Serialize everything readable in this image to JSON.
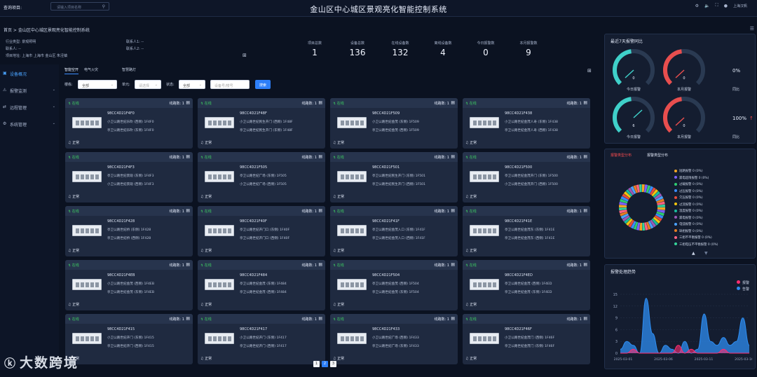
{
  "topbar": {
    "query_label": "查询项目:",
    "query_placeholder": "请输入项目名称",
    "title": "金山区中心城区景观亮化智能控制系统",
    "user": "上海汉帆"
  },
  "breadcrumb": "首页 > 金山区中心城区景观亮化智能控制系统",
  "info": {
    "l1": "行业类型: 景观照明",
    "l2": "联系人: --",
    "l3": "项目地址: 上海市 上海市 金山区 朱泾镇",
    "r1": "联系人1: --",
    "r2": "联系人2: --"
  },
  "stats": [
    {
      "label": "项目总数",
      "value": "1"
    },
    {
      "label": "设备总数",
      "value": "136"
    },
    {
      "label": "在线设备数",
      "value": "132"
    },
    {
      "label": "离线设备数",
      "value": "4"
    },
    {
      "label": "今日报警数",
      "value": "0"
    },
    {
      "label": "本月报警数",
      "value": "9"
    }
  ],
  "sidebar": [
    {
      "label": "设备概况",
      "icon": "monitor-icon"
    },
    {
      "label": "报警监测",
      "icon": "alarm-icon"
    },
    {
      "label": "远程管理",
      "icon": "remote-icon"
    },
    {
      "label": "系统管理",
      "icon": "settings-icon"
    }
  ],
  "tabs": [
    "智能空开",
    "电气火灾",
    "智慧路灯"
  ],
  "filters": {
    "building_label": "楼栋:",
    "building_value": "全部",
    "unit_label": "单元:",
    "unit_placeholder": "请选择",
    "status_label": "状态:",
    "status_value": "全部",
    "device_placeholder": "设备号/楼号",
    "search_btn": "搜索"
  },
  "cards": [
    {
      "status": "在线",
      "lines": "线路数: 1",
      "code": "98CC4D21F4F0",
      "l1": "小卫公路世纪乐吹 (西侧) 1F4F0",
      "l2": "亭卫公路世纪乐吹 (东侧) 1F4F0",
      "state": "正常"
    },
    {
      "status": "在线",
      "lines": "线路数: 1",
      "code": "98CC4D21F48F",
      "l1": "小卫公路世纪民生开门 (西侧) 1F48F",
      "l2": "亭卫公路世纪民生开门 (东侧) 1F48F",
      "state": "正常"
    },
    {
      "status": "在线",
      "lines": "线路数: 1",
      "code": "98CC4D21F509",
      "l1": "小卫公路世纪金茂 (东侧) 1F509",
      "l2": "亭卫公路世纪金茂 (西侧) 1F509",
      "state": "正常"
    },
    {
      "status": "在线",
      "lines": "线路数: 1",
      "code": "98CC4D21F438",
      "l1": "小卫公路世纪金茂人寿 (东侧) 1F438",
      "l2": "亭卫公路世纪金茂人寿 (西侧) 1F438",
      "state": "正常"
    },
    {
      "status": "在线",
      "lines": "线路数: 1",
      "code": "98CC4D21F4F3",
      "l1": "亭卫公路世纪景观 (东侧) 1F4F3",
      "l2": "小卫公路世纪景观 (西侧) 1F4F3",
      "state": "正常"
    },
    {
      "status": "在线",
      "lines": "线路数: 1",
      "code": "98CC4D21F505",
      "l1": "亭卫公路世纪广场 (东侧) 1F505",
      "l2": "小卫公路世纪广场 (西侧) 1F505",
      "state": "正常"
    },
    {
      "status": "在线",
      "lines": "线路数: 1",
      "code": "98CC4D21F501",
      "l1": "亭卫公路世纪民生开门 (东侧) 1F501",
      "l2": "亭卫公路世纪民生开门 (西侧) 1F501",
      "state": "正常"
    },
    {
      "status": "在线",
      "lines": "线路数: 1",
      "code": "98CC4D21F500",
      "l1": "亭卫公路世纪金茂开门 (东侧) 1F500",
      "l2": "小卫公路世纪金茂开门 (西侧) 1F500",
      "state": "正常"
    },
    {
      "status": "在线",
      "lines": "线路数: 1",
      "code": "98CC4D21F428",
      "l1": "亭卫公路世纪桥 (东侧) 1F428",
      "l2": "亭卫公路世纪桥 (西侧) 1F428",
      "state": "正常"
    },
    {
      "status": "在线",
      "lines": "线路数: 1",
      "code": "98CC4D21F40F",
      "l1": "亭卫公路世纪开门口 (东侧) 1F40F",
      "l2": "亭卫公路世纪开门口 (西侧) 1F40F",
      "state": "正常"
    },
    {
      "status": "在线",
      "lines": "线路数: 1",
      "code": "98CC4D21F41F",
      "l1": "亭卫公路世纪金茂入口 (东侧) 1F41F",
      "l2": "亭卫公路世纪金茂入口 (西侧) 1F41F",
      "state": "正常"
    },
    {
      "status": "在线",
      "lines": "线路数: 1",
      "code": "98CC4D21F41E",
      "l1": "亭卫公路世纪金茂东 (东侧) 1F41E",
      "l2": "亭卫公路世纪金茂东 (西侧) 1F41E",
      "state": "正常"
    },
    {
      "status": "在线",
      "lines": "线路数: 1",
      "code": "98CC4D21F4EB",
      "l1": "小卫公路世纪金茂 (西侧) 1F4EB",
      "l2": "亭卫公路世纪金茂 (东侧) 1F4EB",
      "state": "正常"
    },
    {
      "status": "在线",
      "lines": "线路数: 1",
      "code": "98CC4D21F484",
      "l1": "亭卫公路世纪金茂 (东侧) 1F484",
      "l2": "亭卫公路世纪金茂 (西侧) 1F484",
      "state": "正常"
    },
    {
      "status": "在线",
      "lines": "线路数: 1",
      "code": "98CC4D21F504",
      "l1": "亭卫公路世纪金茂 (西侧) 1F504",
      "l2": "亭卫公路世纪金茂 (东侧) 1F504",
      "state": "正常"
    },
    {
      "status": "在线",
      "lines": "线路数: 1",
      "code": "98CC4D21F4ED",
      "l1": "亭卫公路世纪金茂 (西侧) 1F4ED",
      "l2": "亭卫公路世纪金茂 (东侧) 1F4ED",
      "state": "正常"
    },
    {
      "status": "在线",
      "lines": "线路数: 1",
      "code": "98CC4D21F415",
      "l1": "小卫公路世纪开门 (东侧) 1F415",
      "l2": "亭卫公路世纪开门 (西侧) 1F415",
      "state": "正常"
    },
    {
      "status": "在线",
      "lines": "线路数: 1",
      "code": "98CC4D21F417",
      "l1": "小卫公路世纪开门 (东侧) 1F417",
      "l2": "亭卫公路世纪开门 (西侧) 1F417",
      "state": "正常"
    },
    {
      "status": "在线",
      "lines": "线路数: 1",
      "code": "98CC4D21F433",
      "l1": "小卫公路世纪广场 (西侧) 1F433",
      "l2": "亭卫公路世纪广场 (东侧) 1F433",
      "state": "正常"
    },
    {
      "status": "在线",
      "lines": "线路数: 1",
      "code": "98CC4D21F46F",
      "l1": "小卫公路世纪金茂门 (西侧) 1F46F",
      "l2": "亭卫公路世纪金茂门 (东侧) 1F46F",
      "state": "正常"
    }
  ],
  "pager": [
    "1",
    "2",
    "3"
  ],
  "panel1": {
    "title": "最近7天报警同比",
    "g1": "今日报警",
    "g2": "本月报警",
    "g3": "今日报警",
    "g4": "本月报警",
    "v1": "0",
    "v2": "0",
    "v3": "6",
    "v4": "0",
    "pct1": "0%",
    "pct2": "100%",
    "cmp": "同比"
  },
  "panel2": {
    "tab1": "报警类型分布",
    "tab2": "报警类型分布",
    "legend": [
      "短路报警 0 (0%)",
      "漏电超限报警 0 (0%)",
      "过载报警 0 (0%)",
      "过压报警 0 (0%)",
      "欠压报警 0 (0%)",
      "过流报警 0 (0%)",
      "温度报警 0 (0%)",
      "漏电报警 0 (0%)",
      "电弧报警 0 (0%)",
      "缺相报警 0 (0%)",
      "三相不平衡报警 0 (0%)",
      "三相电压不平衡报警 0 (0%)"
    ],
    "colors": [
      "#f5a623",
      "#7b61ff",
      "#2ecc71",
      "#3b8cff",
      "#e74c3c",
      "#f1c40f",
      "#1abc9c",
      "#9b59b6",
      "#4aa3ff",
      "#e67e22",
      "#ff6384",
      "#36d399"
    ]
  },
  "panel3": {
    "title": "报警处理趋势",
    "legend": [
      "报警",
      "告警"
    ],
    "colors": [
      "#ff2d6f",
      "#2d8cf0"
    ],
    "chart_data": {
      "type": "area",
      "x": [
        "2025-03-01",
        "2025-03-06",
        "2025-03-11",
        "2025-03-16"
      ],
      "ylim": [
        0,
        15
      ],
      "yticks": [
        "15",
        "12",
        "9",
        "6",
        "3",
        "0"
      ],
      "series": [
        {
          "name": "报警",
          "values": [
            0,
            0,
            1,
            0,
            0,
            0,
            0,
            0,
            0,
            2,
            0,
            1,
            0,
            0,
            0,
            0,
            1,
            0,
            0,
            0,
            0
          ]
        },
        {
          "name": "告警",
          "values": [
            1,
            3,
            2,
            0,
            14,
            5,
            0,
            2,
            1,
            0,
            3,
            0,
            1,
            10,
            3,
            2,
            4,
            2,
            3,
            9,
            2
          ]
        }
      ]
    }
  },
  "watermark": "大数跨境"
}
